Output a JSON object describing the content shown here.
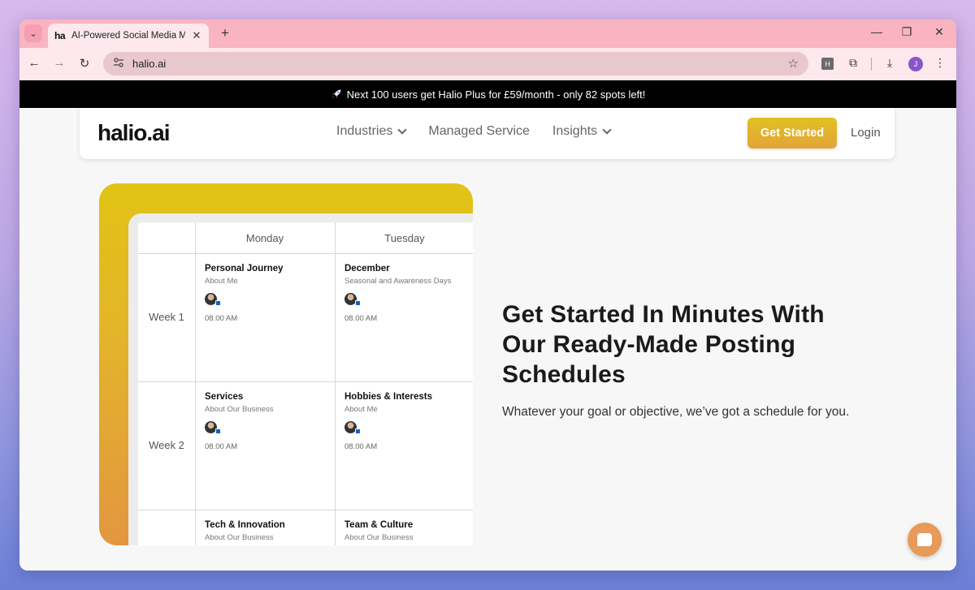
{
  "browser": {
    "tab": {
      "favicon": "ha",
      "title": "AI-Powered Social Media Mana",
      "close": "✕"
    },
    "new_tab": "+",
    "window_controls": {
      "minimize": "—",
      "restore": "❐",
      "close": "✕"
    },
    "toolbar": {
      "back": "←",
      "forward": "→",
      "reload": "↻",
      "site_info_icon": "tune-icon",
      "url": "halio.ai",
      "star": "☆",
      "ext_h": "H",
      "puzzle": "⧉",
      "download": "⤓",
      "profile_initial": "J",
      "menu": "⋮"
    }
  },
  "announcement": {
    "text": "Next 100 users get Halio Plus for £59/month - only 82 spots left!"
  },
  "nav": {
    "logo": "halio.ai",
    "links": [
      {
        "label": "Industries",
        "dropdown": true
      },
      {
        "label": "Managed Service",
        "dropdown": false
      },
      {
        "label": "Insights",
        "dropdown": true
      }
    ],
    "cta": "Get Started",
    "login": "Login"
  },
  "schedule": {
    "days": [
      "Monday",
      "Tuesday"
    ],
    "weeks": [
      {
        "label": "Week 1",
        "cells": [
          {
            "title": "Personal Journey",
            "sub": "About Me",
            "time": "08.00 AM"
          },
          {
            "title": "December",
            "sub": "Seasonal and Awareness Days",
            "time": "08.00 AM"
          }
        ]
      },
      {
        "label": "Week 2",
        "cells": [
          {
            "title": "Services",
            "sub": "About Our Business",
            "time": "08.00 AM"
          },
          {
            "title": "Hobbies & Interests",
            "sub": "About Me",
            "time": "08.00 AM"
          }
        ]
      },
      {
        "label": "",
        "cells": [
          {
            "title": "Tech & Innovation",
            "sub": "About Our Business",
            "time": ""
          },
          {
            "title": "Team & Culture",
            "sub": "About Our Business",
            "time": ""
          }
        ]
      }
    ]
  },
  "hero": {
    "title": "Get Started In Minutes With Our Ready-Made Posting Schedules",
    "subtitle": "Whatever your goal or objective, we’ve got a schedule for you."
  },
  "chat": {
    "icon": "chat-bubble-icon"
  }
}
